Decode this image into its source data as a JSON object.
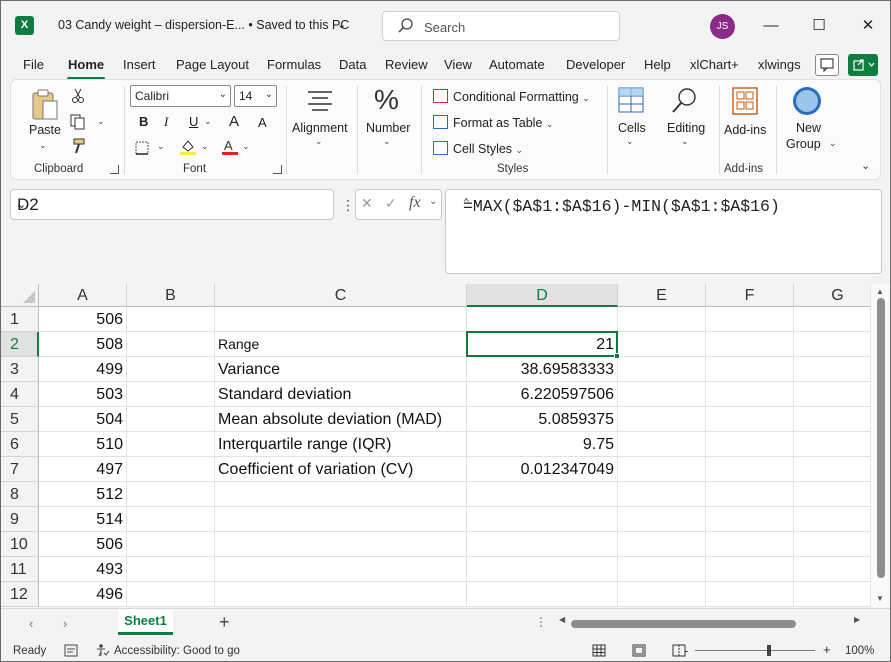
{
  "window": {
    "title": "03 Candy weight – dispersion-E...  •  Saved to this PC",
    "search_placeholder": "Search",
    "avatar_initials": "JS",
    "accent_color": "#107c41"
  },
  "menu_tabs": [
    "File",
    "Home",
    "Insert",
    "Page Layout",
    "Formulas",
    "Data",
    "Review",
    "View",
    "Automate",
    "Developer",
    "Help",
    "xlChart+",
    "xlwings"
  ],
  "ribbon": {
    "clipboard": {
      "paste_label": "Paste",
      "group_label": "Clipboard"
    },
    "font": {
      "font_name": "Calibri",
      "font_size": "14",
      "bold": "B",
      "italic": "I",
      "underline": "U",
      "grow": "A",
      "shrink": "A",
      "group_label": "Font"
    },
    "alignment_label": "Alignment",
    "number_label": "Number",
    "styles": {
      "conditional": "Conditional Formatting",
      "format_table": "Format as Table",
      "cell_styles": "Cell Styles",
      "group_label": "Styles"
    },
    "cells_label": "Cells",
    "editing_label": "Editing",
    "addins": {
      "label": "Add-ins",
      "group_label": "Add-ins"
    },
    "newgroup": {
      "line1": "New",
      "line2": "Group"
    }
  },
  "formula_bar": {
    "name_box": "D2",
    "fx": "fx",
    "formula": "=MAX($A$1:$A$16)-MIN($A$1:$A$16)"
  },
  "grid": {
    "columns": [
      "A",
      "B",
      "C",
      "D",
      "E",
      "F",
      "G"
    ],
    "selected_column": "D",
    "selected_row": "2",
    "rows": [
      {
        "n": "1",
        "A": "506",
        "C": "",
        "D": ""
      },
      {
        "n": "2",
        "A": "508",
        "C": "Range",
        "D": "21"
      },
      {
        "n": "3",
        "A": "499",
        "C": "Variance",
        "D": "38.69583333"
      },
      {
        "n": "4",
        "A": "503",
        "C": "Standard deviation",
        "D": "6.220597506"
      },
      {
        "n": "5",
        "A": "504",
        "C": "Mean absolute deviation (MAD)",
        "D": "5.0859375"
      },
      {
        "n": "6",
        "A": "510",
        "C": "Interquartile range (IQR)",
        "D": "9.75"
      },
      {
        "n": "7",
        "A": "497",
        "C": "Coefficient of variation (CV)",
        "D": "0.012347049"
      },
      {
        "n": "8",
        "A": "512",
        "C": "",
        "D": ""
      },
      {
        "n": "9",
        "A": "514",
        "C": "",
        "D": ""
      },
      {
        "n": "10",
        "A": "506",
        "C": "",
        "D": ""
      },
      {
        "n": "11",
        "A": "493",
        "C": "",
        "D": ""
      },
      {
        "n": "12",
        "A": "496",
        "C": "",
        "D": ""
      }
    ]
  },
  "sheets": {
    "active": "Sheet1",
    "add": "+"
  },
  "status": {
    "ready": "Ready",
    "accessibility": "Accessibility: Good to go",
    "zoom": "100%",
    "zoom_minus": "-",
    "zoom_plus": "+"
  }
}
